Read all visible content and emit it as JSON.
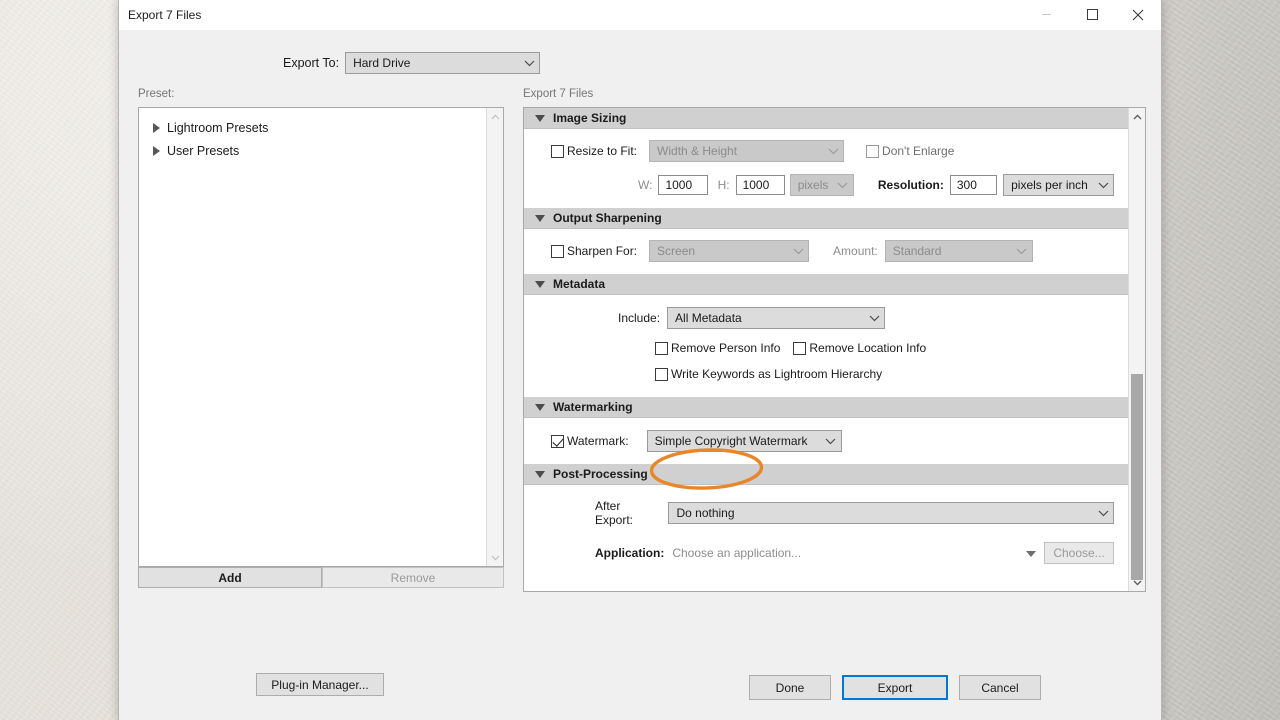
{
  "window": {
    "title": "Export 7 Files",
    "minimize_icon": "minimize-icon",
    "maximize_icon": "maximize-icon",
    "close_icon": "close-icon"
  },
  "export_to": {
    "label": "Export To:",
    "value": "Hard Drive"
  },
  "left": {
    "preset_label": "Preset:",
    "presets": [
      {
        "label": "Lightroom Presets",
        "expanded": false
      },
      {
        "label": "User Presets",
        "expanded": false
      }
    ],
    "add_label": "Add",
    "remove_label": "Remove"
  },
  "right": {
    "panel_label": "Export 7 Files",
    "sections": {
      "image_sizing": {
        "title": "Image Sizing",
        "resize_to_fit": {
          "label": "Resize to Fit:",
          "checked": false
        },
        "resize_mode": {
          "value": "Width & Height",
          "disabled": true
        },
        "dont_enlarge": {
          "label": "Don't Enlarge",
          "checked": false,
          "disabled": true
        },
        "w_label": "W:",
        "w_value": "1000",
        "h_label": "H:",
        "h_value": "1000",
        "units": {
          "value": "pixels",
          "disabled": true
        },
        "resolution_label": "Resolution:",
        "resolution_value": "300",
        "resolution_units": {
          "value": "pixels per inch",
          "disabled": false
        }
      },
      "output_sharpening": {
        "title": "Output Sharpening",
        "sharpen_for": {
          "label": "Sharpen For:",
          "checked": false
        },
        "sharpen_target": {
          "value": "Screen",
          "disabled": true
        },
        "amount_label": "Amount:",
        "amount": {
          "value": "Standard",
          "disabled": true
        }
      },
      "metadata": {
        "title": "Metadata",
        "include_label": "Include:",
        "include_value": "All Metadata",
        "remove_person_info": {
          "label": "Remove Person Info",
          "checked": false
        },
        "remove_location_info": {
          "label": "Remove Location Info",
          "checked": false
        },
        "write_keywords": {
          "label": "Write Keywords as Lightroom Hierarchy",
          "checked": false
        }
      },
      "watermarking": {
        "title": "Watermarking",
        "watermark": {
          "label": "Watermark:",
          "checked": true
        },
        "watermark_preset": {
          "value": "Simple Copyright Watermark"
        },
        "annotation_color": "#E8862A"
      },
      "post_processing": {
        "title": "Post-Processing",
        "after_export_label": "After Export:",
        "after_export_value": "Do nothing",
        "application_label": "Application:",
        "application_placeholder": "Choose an application...",
        "choose_label": "Choose..."
      }
    }
  },
  "footer": {
    "plugin_manager_label": "Plug-in Manager...",
    "done_label": "Done",
    "export_label": "Export",
    "cancel_label": "Cancel",
    "focus_color": "#0078D7"
  }
}
